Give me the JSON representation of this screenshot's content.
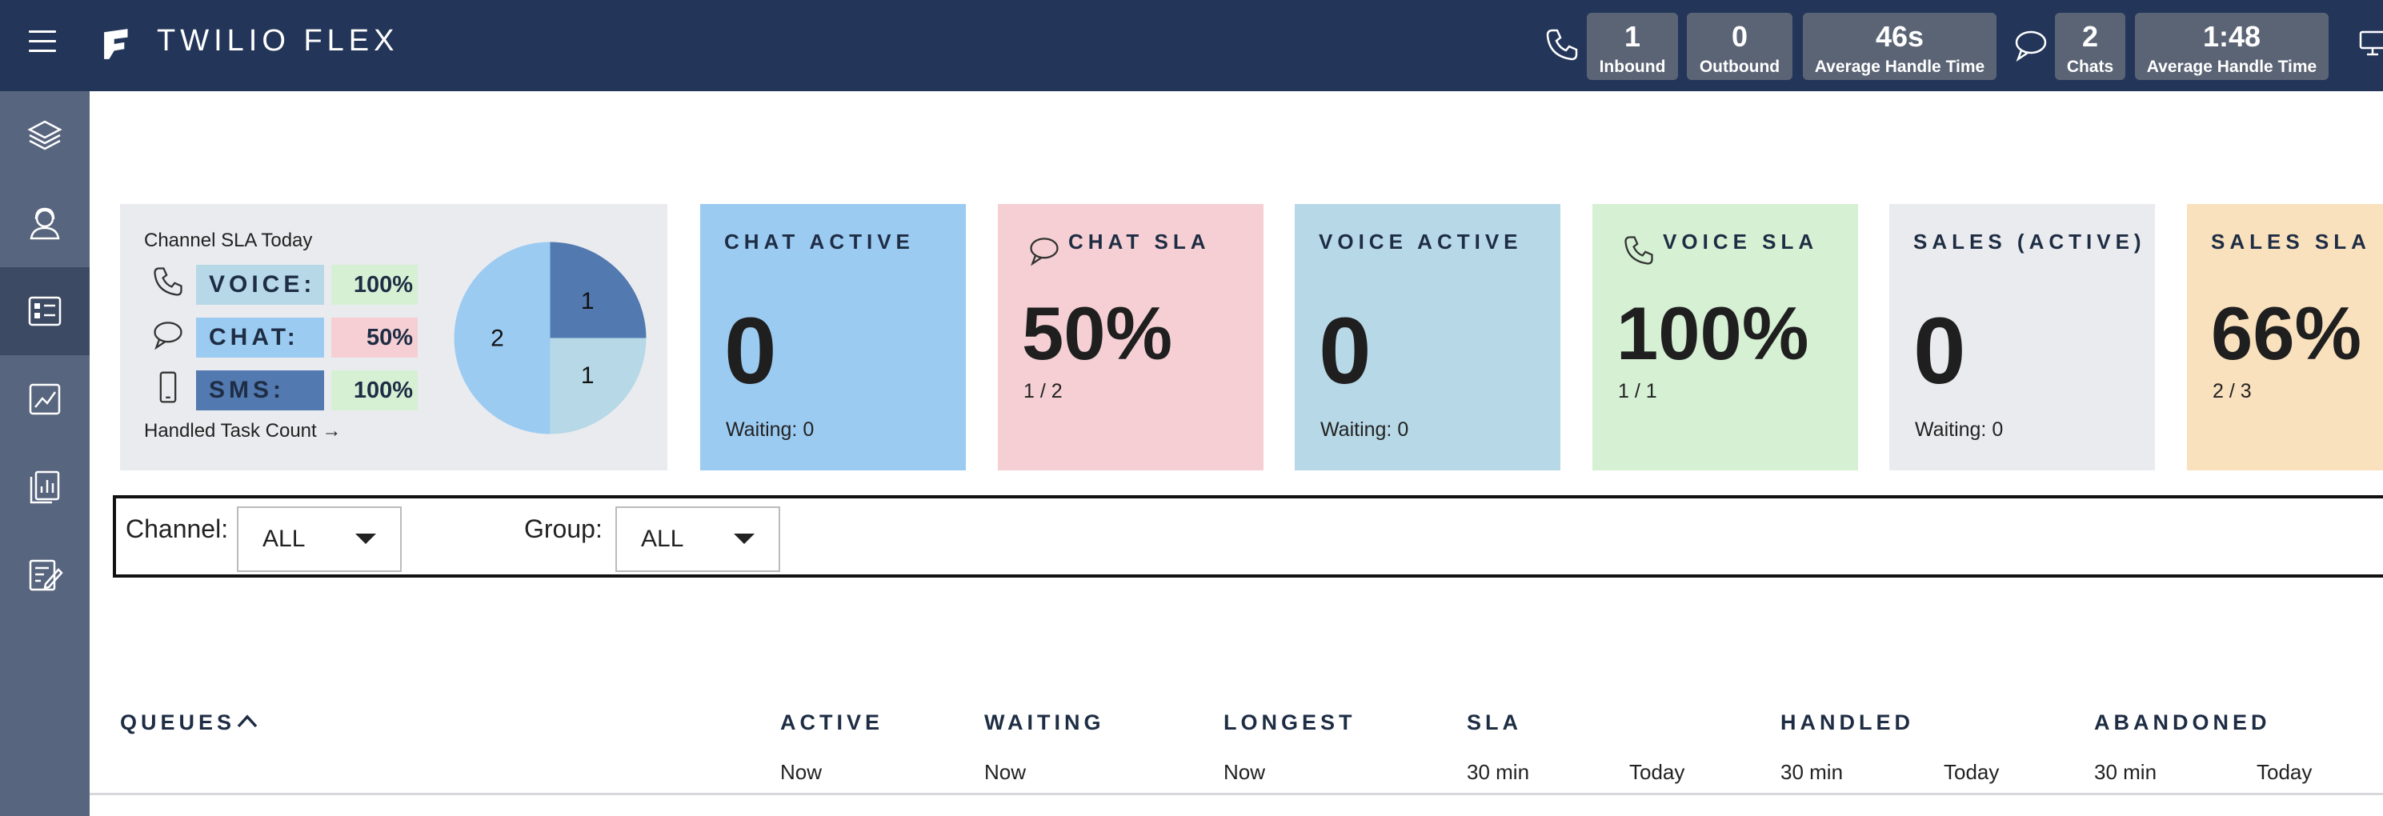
{
  "header": {
    "brand": "TWILIO FLEX",
    "stats": [
      {
        "value": "1",
        "label": "Inbound"
      },
      {
        "value": "0",
        "label": "Outbound"
      },
      {
        "value": "46s",
        "label": "Average Handle Time"
      },
      {
        "value": "2",
        "label": "Chats"
      },
      {
        "value": "1:48",
        "label": "Average Handle Time"
      }
    ]
  },
  "sidebar": {
    "items": [
      {
        "icon": "layers-icon"
      },
      {
        "icon": "agents-icon"
      },
      {
        "icon": "queue-stats-icon",
        "active": true
      },
      {
        "icon": "analytics-icon"
      },
      {
        "icon": "reports-icon"
      },
      {
        "icon": "edit-form-icon"
      }
    ]
  },
  "sla_summary": {
    "title": "Channel SLA Today",
    "rows": [
      {
        "channel": "VOICE:",
        "pct": "100%",
        "label_color": "#b7d8e6",
        "pct_color": "#d6f0d4"
      },
      {
        "channel": "CHAT:",
        "pct": "50%",
        "label_color": "#9ccbf2",
        "pct_color": "#f5cfd4"
      },
      {
        "channel": "SMS:",
        "pct": "100%",
        "label_color": "#5279b0",
        "pct_color": "#d6f0d4"
      }
    ],
    "footer": "Handled Task Count →",
    "pie": [
      {
        "label": "2",
        "value": 2,
        "color": "#9ccbf2"
      },
      {
        "label": "1",
        "value": 1,
        "color": "#5279b0"
      },
      {
        "label": "1",
        "value": 1,
        "color": "#b7d8e6"
      }
    ]
  },
  "tiles": [
    {
      "title": "CHAT ACTIVE",
      "value": "0",
      "sub": "Waiting: 0",
      "color": "#9ccbf2",
      "icon": ""
    },
    {
      "title": "CHAT SLA",
      "value": "50%",
      "sub": "1 / 2",
      "color": "#f5cfd4",
      "icon": "chat-icon"
    },
    {
      "title": "VOICE ACTIVE",
      "value": "0",
      "sub": "Waiting: 0",
      "color": "#b7d8e6",
      "icon": ""
    },
    {
      "title": "VOICE SLA",
      "value": "100%",
      "sub": "1 / 1",
      "color": "#d6f0d4",
      "icon": "phone-icon"
    },
    {
      "title": "SALES (ACTIVE)",
      "value": "0",
      "sub": "Waiting: 0",
      "color": "#eaebee",
      "icon": ""
    },
    {
      "title": "SALES SLA",
      "value": "66%",
      "sub": "2 / 3",
      "color": "#f9e1bd",
      "icon": ""
    }
  ],
  "filters": {
    "channel_label": "Channel:",
    "channel_value": "ALL",
    "group_label": "Group:",
    "group_value": "ALL"
  },
  "queues_table": {
    "title": "QUEUES",
    "columns": [
      {
        "name": "ACTIVE",
        "subs": [
          "Now"
        ]
      },
      {
        "name": "WAITING",
        "subs": [
          "Now"
        ]
      },
      {
        "name": "LONGEST",
        "subs": [
          "Now"
        ]
      },
      {
        "name": "SLA",
        "subs": [
          "30 min",
          "Today"
        ]
      },
      {
        "name": "HANDLED",
        "subs": [
          "30 min",
          "Today"
        ]
      },
      {
        "name": "ABANDONED",
        "subs": [
          "30 min",
          "Today"
        ]
      }
    ]
  }
}
